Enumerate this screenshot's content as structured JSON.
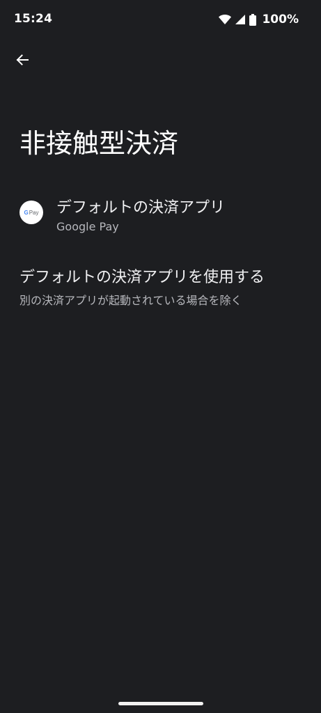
{
  "status_bar": {
    "time": "15:24",
    "battery_percent": "100%",
    "icons": [
      "wifi-icon",
      "cellular-signal-icon",
      "battery-icon"
    ]
  },
  "header": {
    "back_icon": "arrow-left-icon"
  },
  "page": {
    "title": "非接触型決済"
  },
  "preferences": [
    {
      "icon": "google-pay-icon",
      "icon_text_g": "G",
      "icon_text": "Pay",
      "title": "デフォルトの決済アプリ",
      "summary": "Google Pay"
    },
    {
      "title": "デフォルトの決済アプリを使用する",
      "summary": "別の決済アプリが起動されている場合を除く"
    }
  ],
  "colors": {
    "background": "#1d1e21",
    "text_primary": "#f1f1f3",
    "text_secondary": "#b7b8bd"
  }
}
